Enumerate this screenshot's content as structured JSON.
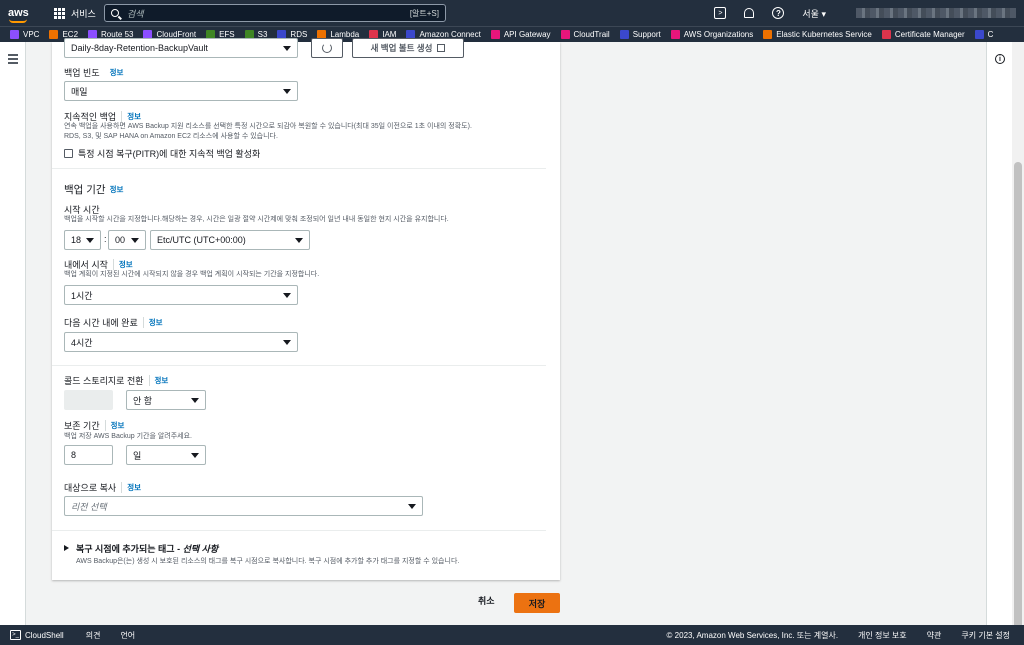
{
  "topnav": {
    "logo": "aws",
    "services_label": "서비스",
    "search_placeholder": "검색",
    "search_shortcut": "[알트+S]",
    "region": "서울 ▾"
  },
  "favorites": [
    {
      "label": "VPC",
      "color": "#8c4fff"
    },
    {
      "label": "EC2",
      "color": "#ed7100"
    },
    {
      "label": "Route 53",
      "color": "#8c4fff"
    },
    {
      "label": "CloudFront",
      "color": "#8c4fff"
    },
    {
      "label": "EFS",
      "color": "#3f8624"
    },
    {
      "label": "S3",
      "color": "#3f8624"
    },
    {
      "label": "RDS",
      "color": "#3b48cc"
    },
    {
      "label": "Lambda",
      "color": "#ed7100"
    },
    {
      "label": "IAM",
      "color": "#dd344c"
    },
    {
      "label": "Amazon Connect",
      "color": "#3b48cc"
    },
    {
      "label": "API Gateway",
      "color": "#e7157b"
    },
    {
      "label": "CloudTrail",
      "color": "#e7157b"
    },
    {
      "label": "Support",
      "color": "#3b48cc"
    },
    {
      "label": "AWS Organizations",
      "color": "#e7157b"
    },
    {
      "label": "Elastic Kubernetes Service",
      "color": "#ed7100"
    },
    {
      "label": "Certificate Manager",
      "color": "#dd344c"
    },
    {
      "label": "C",
      "color": "#3b48cc"
    }
  ],
  "form": {
    "vault_select": "Daily-8day-Retention-BackupVault",
    "create_vault_button": "새 백업 볼트 생성",
    "frequency": {
      "label": "백업 빈도",
      "info": "정보",
      "value": "매일"
    },
    "continuous": {
      "label": "지속적인 백업",
      "info": "정보",
      "desc_line1": "연속 백업을 사용하면 AWS Backup 지원 리소스를 선택한 특정 시간으로 되감아 복원할 수 있습니다(최대 35일 이전으로 1초 이내의 정확도).",
      "desc_line2": "RDS, S3, 및 SAP HANA on Amazon EC2 리소스에 사용할 수 있습니다.",
      "checkbox_label": "특정 시점 복구(PITR)에 대한 지속적 백업 활성화"
    },
    "window": {
      "heading": "백업 기간",
      "info": "정보"
    },
    "start_time": {
      "label": "시작 시간",
      "desc": "백업을 시작할 시간을 지정합니다.해당하는 경우, 시간은 일광 절약 시간제에 맞춰 조정되어 일년 내내 동일한 현지 시간을 유지합니다.",
      "hour": "18",
      "minute": "00",
      "timezone": "Etc/UTC (UTC+00:00)"
    },
    "start_within": {
      "label": "내에서 시작",
      "info": "정보",
      "desc": "백업 계획이 지정된 시간에 시작되지 않을 경우 백업 계획이 시작되는 기간을 지정합니다.",
      "value": "1시간"
    },
    "complete_within": {
      "label": "다음 시간 내에 완료",
      "info": "정보",
      "value": "4시간"
    },
    "cold_storage": {
      "label": "콜드 스토리지로 전환",
      "info": "정보",
      "value": "안 함"
    },
    "retention": {
      "label": "보존 기간",
      "info": "정보",
      "desc": "백업 저장 AWS Backup 기간을 알려주세요.",
      "amount": "8",
      "unit": "일"
    },
    "copy_to": {
      "label": "대상으로 복사",
      "info": "정보",
      "placeholder": "리전 선택"
    },
    "tags": {
      "title": "복구 시점에 추가되는 태그 - ",
      "optional": "선택 사항",
      "desc": "AWS Backup은(는) 생성 시 보호된 리소스의 태그를 복구 시점으로 복사합니다. 복구 시점에 추가할 추가 태그를 지정할 수 있습니다."
    }
  },
  "actions": {
    "cancel": "취소",
    "save": "저장"
  },
  "footer": {
    "cloudshell": "CloudShell",
    "feedback": "의견",
    "language": "언어",
    "copyright": "© 2023, Amazon Web Services, Inc. 또는 계열사.",
    "privacy": "개인 정보 보호",
    "terms": "약관",
    "cookies": "쿠키 기본 설정"
  }
}
